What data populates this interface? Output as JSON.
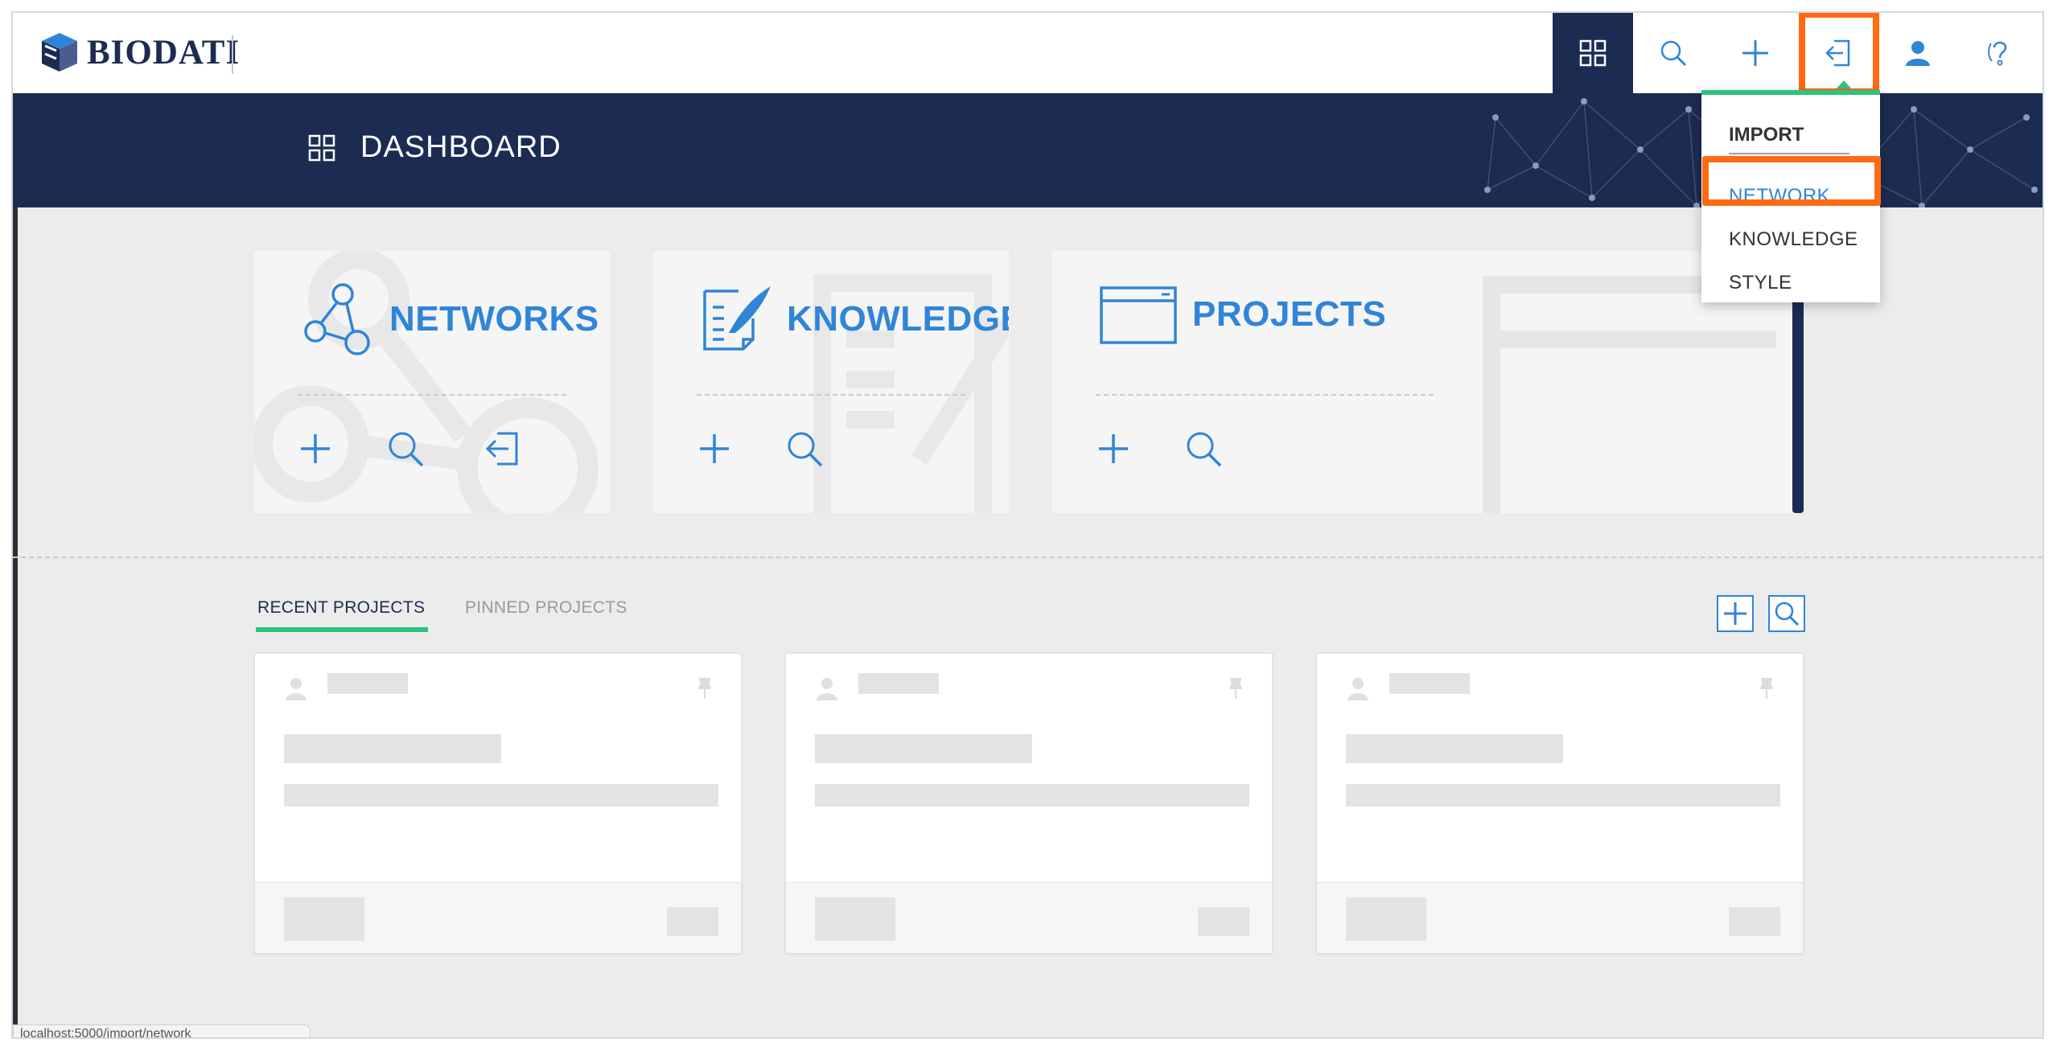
{
  "app": {
    "logo_text": "BIODATI"
  },
  "topnav": {
    "items": [
      {
        "name": "dashboard",
        "icon": "grid-icon"
      },
      {
        "name": "search",
        "icon": "search-icon"
      },
      {
        "name": "add",
        "icon": "plus-icon"
      },
      {
        "name": "import",
        "icon": "import-icon"
      },
      {
        "name": "account",
        "icon": "user-icon"
      },
      {
        "name": "help",
        "icon": "help-icon"
      }
    ]
  },
  "banner": {
    "title": "DASHBOARD"
  },
  "import_menu": {
    "heading": "IMPORT",
    "items": [
      "NETWORK",
      "KNOWLEDGE",
      "STYLE"
    ],
    "selected": "NETWORK"
  },
  "tiles": {
    "networks": {
      "label": "NETWORKS"
    },
    "knowledge": {
      "label": "KNOWLEDGE"
    },
    "projects": {
      "label": "PROJECTS"
    }
  },
  "tabs": {
    "recent": "RECENT PROJECTS",
    "pinned": "PINNED PROJECTS"
  },
  "status_bar": {
    "url": "localhost:5000/import/network"
  },
  "colors": {
    "navy": "#1c2b52",
    "accent_blue": "#2f85d8",
    "green": "#2ec27e",
    "highlight": "#ff6a13"
  }
}
